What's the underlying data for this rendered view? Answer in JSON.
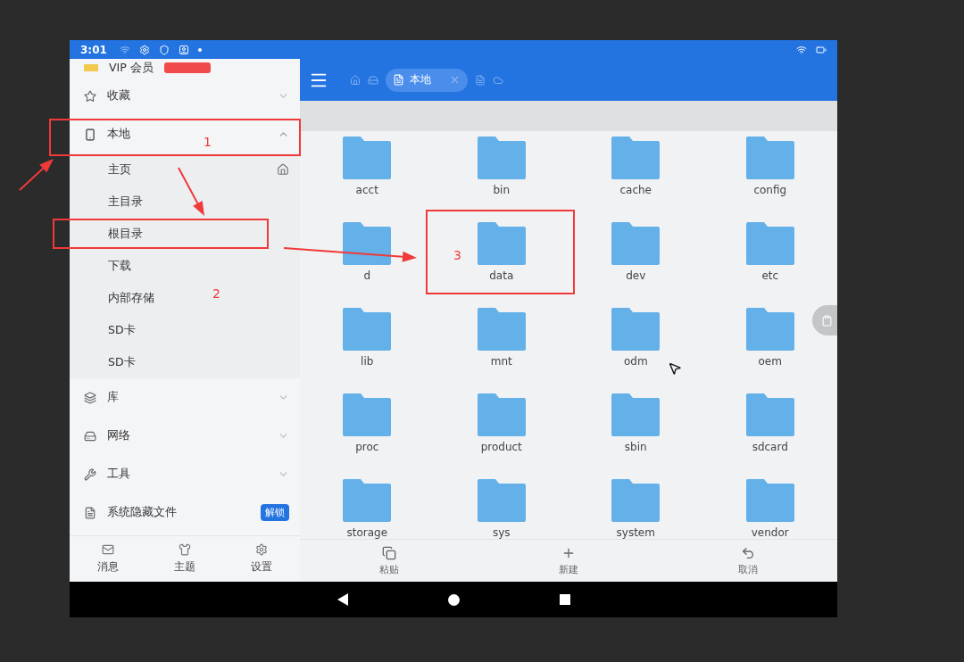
{
  "status_bar": {
    "time": "3:01"
  },
  "drawer": {
    "vip": {
      "label": "VIP 会员"
    },
    "items": [
      {
        "label": "收藏",
        "expanded": false
      },
      {
        "label": "本地",
        "expanded": true,
        "children": [
          {
            "label": "主页"
          },
          {
            "label": "主目录"
          },
          {
            "label": "根目录"
          },
          {
            "label": "下载"
          },
          {
            "label": "内部存储"
          },
          {
            "label": "SD卡"
          },
          {
            "label": "SD卡"
          }
        ]
      },
      {
        "label": "库",
        "expanded": false
      },
      {
        "label": "网络",
        "expanded": false
      },
      {
        "label": "工具",
        "expanded": false
      },
      {
        "label": "系统隐藏文件",
        "badge": "解锁"
      }
    ],
    "tabs": [
      {
        "label": "消息"
      },
      {
        "label": "主题"
      },
      {
        "label": "设置"
      }
    ]
  },
  "toolbar": {
    "path_chip": {
      "label": "本地"
    }
  },
  "folders": [
    "acct",
    "bin",
    "cache",
    "config",
    "d",
    "data",
    "dev",
    "etc",
    "lib",
    "mnt",
    "odm",
    "oem",
    "proc",
    "product",
    "sbin",
    "sdcard",
    "storage",
    "sys",
    "system",
    "vendor"
  ],
  "actions": [
    {
      "label": "粘贴"
    },
    {
      "label": "新建"
    },
    {
      "label": "取消"
    }
  ],
  "annotations": [
    {
      "label": "1"
    },
    {
      "label": "2"
    },
    {
      "label": "3"
    }
  ]
}
